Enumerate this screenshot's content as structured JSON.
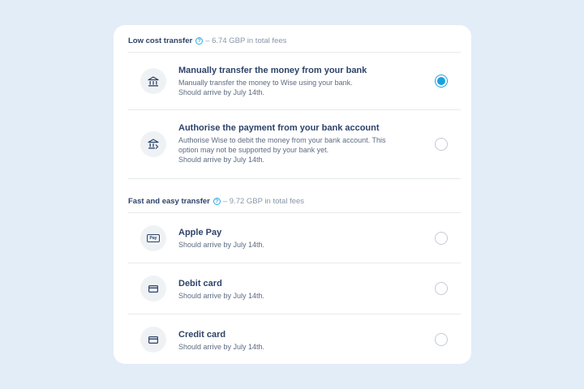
{
  "sections": [
    {
      "title": "Low cost transfer",
      "help_icon": "?",
      "fees": "– 6.74 GBP in total fees",
      "options": [
        {
          "name": "Manually transfer the money from your bank",
          "desc_lines": [
            "Manually transfer the money to Wise using your bank.",
            "Should arrive by July 14th."
          ],
          "icon": "bank-icon",
          "selected": true
        },
        {
          "name": "Authorise the payment from your bank account",
          "desc_lines": [
            "Authorise Wise to debit the money from your bank account. This",
            "option may not be supported by your bank yet.",
            "Should arrive by July 14th."
          ],
          "icon": "bank-authorise-icon",
          "selected": false
        }
      ]
    },
    {
      "title": "Fast and easy transfer",
      "help_icon": "?",
      "fees": "– 9.72 GBP in total fees",
      "options": [
        {
          "name": "Apple Pay",
          "desc_lines": [
            "Should arrive by July 14th."
          ],
          "icon": "apple-pay-icon",
          "icon_text": "Pay",
          "selected": false
        },
        {
          "name": "Debit card",
          "desc_lines": [
            "Should arrive by July 14th."
          ],
          "icon": "card-icon",
          "selected": false
        },
        {
          "name": "Credit card",
          "desc_lines": [
            "Should arrive by July 14th."
          ],
          "icon": "card-icon",
          "selected": false
        }
      ]
    }
  ],
  "colors": {
    "background": "#e3edf7",
    "card": "#ffffff",
    "text": "#2e4369",
    "accent": "#1aa1e0",
    "muted": "#8a96a8"
  }
}
